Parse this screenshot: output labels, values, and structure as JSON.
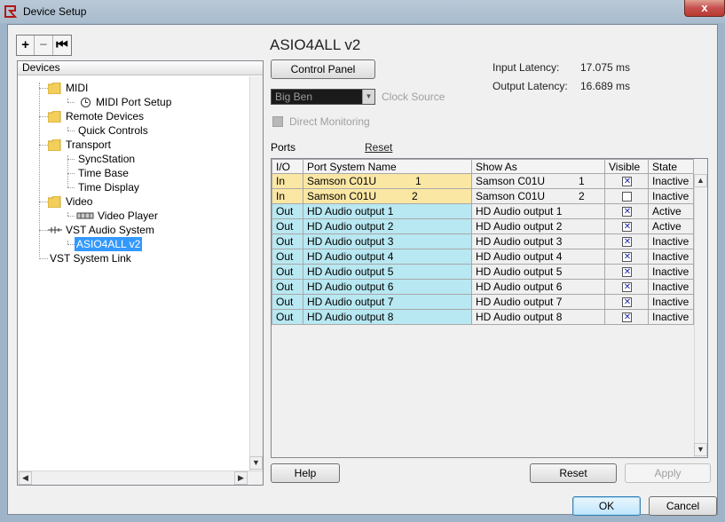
{
  "window": {
    "title": "Device Setup",
    "close_glyph": "x"
  },
  "left": {
    "toolbar": [
      "+",
      "−",
      "⏮"
    ],
    "tree_header": "Devices",
    "tree": [
      {
        "label": "MIDI",
        "icon": "folder-icon"
      },
      {
        "label": "MIDI Port Setup",
        "icon": "clock-icon"
      },
      {
        "label": "Remote Devices",
        "icon": "folder-icon"
      },
      {
        "label": "Quick Controls",
        "icon": ""
      },
      {
        "label": "Transport",
        "icon": "folder-icon"
      },
      {
        "label": "SyncStation",
        "icon": ""
      },
      {
        "label": "Time Base",
        "icon": ""
      },
      {
        "label": "Time Display",
        "icon": ""
      },
      {
        "label": "Video",
        "icon": "folder-icon"
      },
      {
        "label": "Video Player",
        "icon": "video-icon"
      },
      {
        "label": "VST Audio System",
        "icon": "audio-icon"
      },
      {
        "label": "ASIO4ALL v2",
        "icon": ""
      },
      {
        "label": "VST System Link",
        "icon": ""
      }
    ]
  },
  "right": {
    "device_title": "ASIO4ALL v2",
    "control_panel": "Control Panel",
    "input_latency_label": "Input Latency:",
    "input_latency_value": "17.075 ms",
    "output_latency_label": "Output Latency:",
    "output_latency_value": "16.689 ms",
    "clock_value": "Big Ben",
    "clock_source_label": "Clock Source",
    "direct_monitoring": "Direct Monitoring",
    "ports_label": "Ports",
    "reset_link": "Reset",
    "columns": [
      "I/O",
      "Port System Name",
      "Show As",
      "Visible",
      "State"
    ],
    "rows": [
      {
        "io": "In",
        "name": "Samson C01U",
        "name_num": "1",
        "show": "Samson C01U",
        "show_num": "1",
        "visible": true,
        "state": "Inactive"
      },
      {
        "io": "In",
        "name": "Samson C01U",
        "name_num": "2",
        "show": "Samson C01U",
        "show_num": "2",
        "visible": false,
        "state": "Inactive"
      },
      {
        "io": "Out",
        "name": "HD Audio output 1",
        "name_num": "",
        "show": "HD Audio output 1",
        "show_num": "",
        "visible": true,
        "state": "Active"
      },
      {
        "io": "Out",
        "name": "HD Audio output 2",
        "name_num": "",
        "show": "HD Audio output 2",
        "show_num": "",
        "visible": true,
        "state": "Active"
      },
      {
        "io": "Out",
        "name": "HD Audio output 3",
        "name_num": "",
        "show": "HD Audio output 3",
        "show_num": "",
        "visible": true,
        "state": "Inactive"
      },
      {
        "io": "Out",
        "name": "HD Audio output 4",
        "name_num": "",
        "show": "HD Audio output 4",
        "show_num": "",
        "visible": true,
        "state": "Inactive"
      },
      {
        "io": "Out",
        "name": "HD Audio output 5",
        "name_num": "",
        "show": "HD Audio output 5",
        "show_num": "",
        "visible": true,
        "state": "Inactive"
      },
      {
        "io": "Out",
        "name": "HD Audio output 6",
        "name_num": "",
        "show": "HD Audio output 6",
        "show_num": "",
        "visible": true,
        "state": "Inactive"
      },
      {
        "io": "Out",
        "name": "HD Audio output 7",
        "name_num": "",
        "show": "HD Audio output 7",
        "show_num": "",
        "visible": true,
        "state": "Inactive"
      },
      {
        "io": "Out",
        "name": "HD Audio output 8",
        "name_num": "",
        "show": "HD Audio output 8",
        "show_num": "",
        "visible": true,
        "state": "Inactive"
      }
    ],
    "help": "Help",
    "reset": "Reset",
    "apply": "Apply"
  },
  "footer": {
    "ok": "OK",
    "cancel": "Cancel"
  },
  "colors": {
    "in_row": "#fbe7a4",
    "out_row": "#b8e8f2",
    "selection": "#3399ff",
    "title_bar": "#b9c9d8"
  }
}
